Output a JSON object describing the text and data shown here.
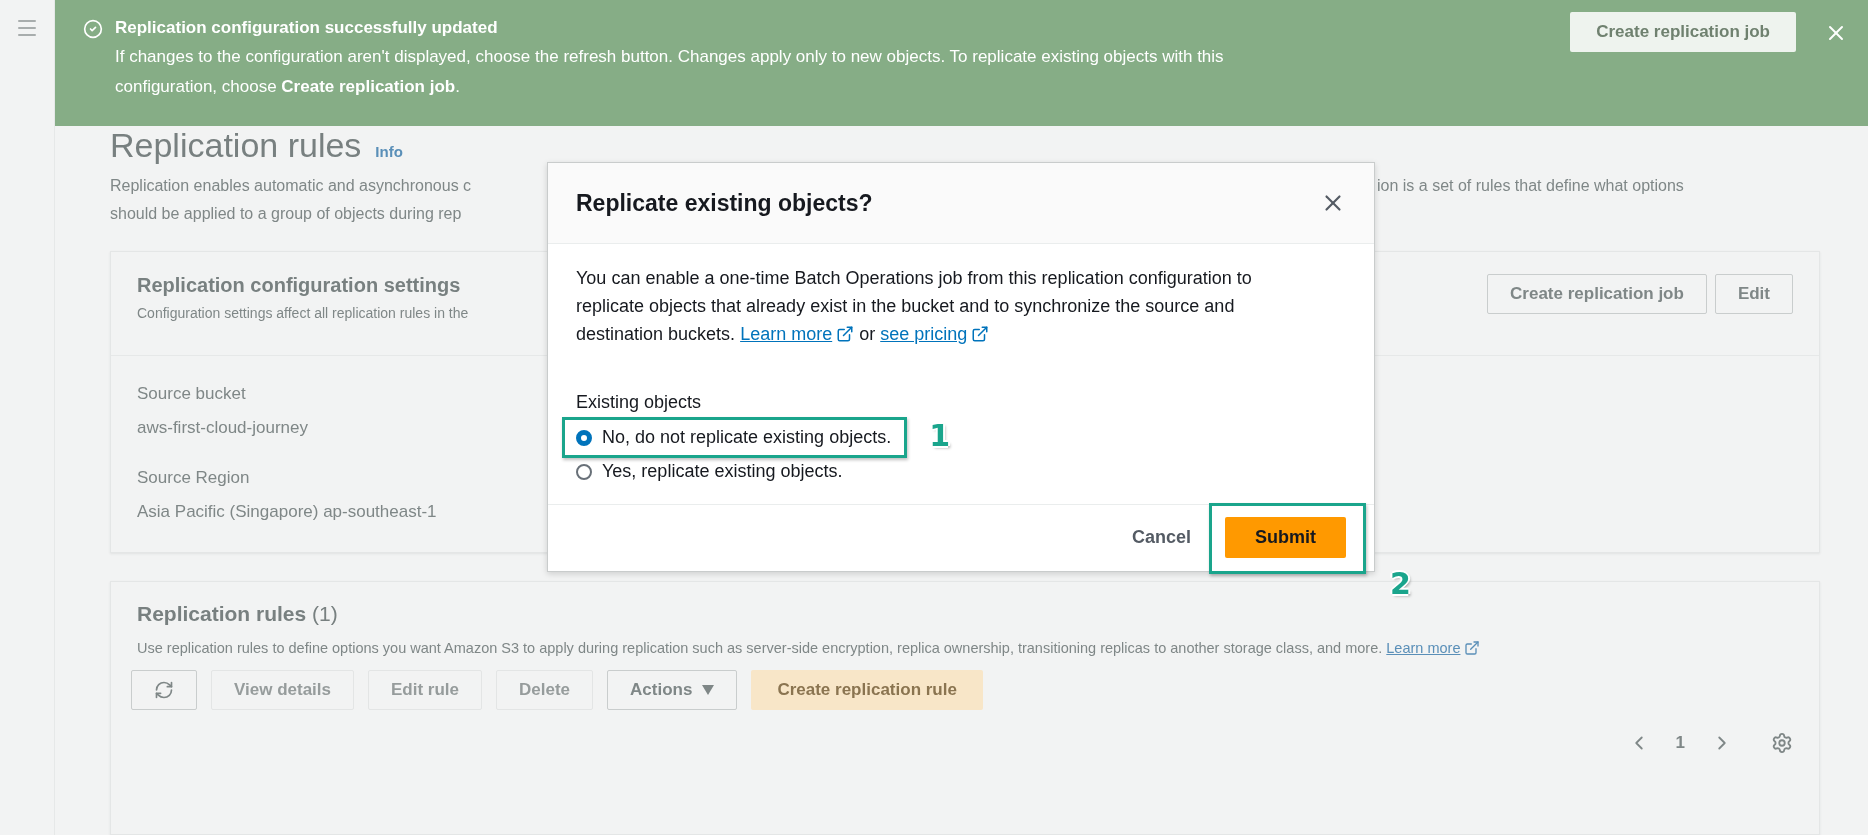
{
  "banner": {
    "title": "Replication configuration successfully updated",
    "message": "If changes to the configuration aren't displayed, choose the refresh button. Changes apply only to new objects. To replicate existing objects with this configuration, choose **Create replication job**.",
    "button": "Create replication job"
  },
  "page": {
    "title": "Replication rules",
    "info": "Info",
    "description_left": [
      "Replication enables automatic and asynchronous c",
      "should be applied to a group of objects during rep"
    ],
    "description_right": [
      "ion is a set of rules that define what options"
    ]
  },
  "config_card": {
    "title": "Replication configuration settings",
    "subtitle": "Configuration settings affect all replication rules in the",
    "buttons": [
      "Create replication job",
      "Edit"
    ],
    "fields": [
      {
        "label": "Source bucket",
        "value": "aws-first-cloud-journey"
      },
      {
        "label": "Source Region",
        "value": "Asia Pacific (Singapore) ap-southeast-1"
      }
    ]
  },
  "rules_card": {
    "title": "Replication rules",
    "count": "(1)",
    "description": "Use replication rules to define options you want Amazon S3 to apply during replication such as server-side encryption, replica ownership, transitioning replicas to another storage class, and more.",
    "learn_more": "Learn more",
    "toolbar": [
      {
        "kind": "refresh",
        "disabled": false
      },
      {
        "kind": "button",
        "label": "View details",
        "disabled": true
      },
      {
        "kind": "button",
        "label": "Edit rule",
        "disabled": true
      },
      {
        "kind": "button",
        "label": "Delete",
        "disabled": true
      },
      {
        "kind": "dropdown",
        "label": "Actions",
        "disabled": false
      },
      {
        "kind": "primary",
        "label": "Create replication rule",
        "disabled": false
      }
    ],
    "page_number": "1"
  },
  "modal": {
    "title": "Replicate existing objects?",
    "body": "You can enable a one-time Batch Operations job from this replication configuration to replicate objects that already exist in the bucket and to synchronize the source and destination buckets.",
    "links": [
      "Learn more",
      "see pricing"
    ],
    "connector": "or",
    "group_label": "Existing objects",
    "options": [
      {
        "label": "No, do not replicate existing objects.",
        "selected": true
      },
      {
        "label": "Yes, replicate existing objects.",
        "selected": false
      }
    ],
    "cancel": "Cancel",
    "submit": "Submit"
  },
  "annotations": [
    {
      "label": "1"
    },
    {
      "label": "2"
    }
  ]
}
